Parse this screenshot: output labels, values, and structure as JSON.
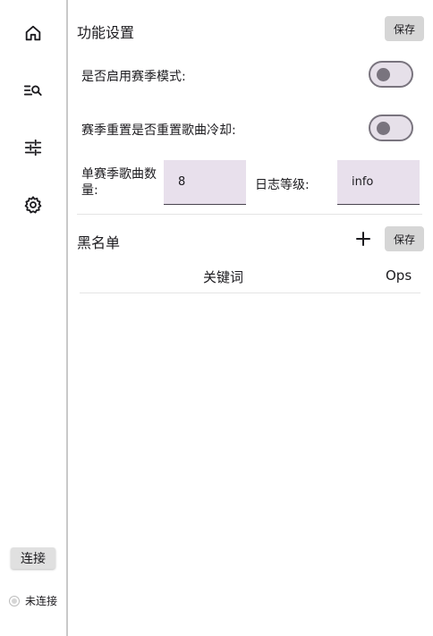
{
  "sidebar": {
    "nav": [
      {
        "icon": "home-icon"
      },
      {
        "icon": "search-list-icon"
      },
      {
        "icon": "tune-sliders-icon"
      },
      {
        "icon": "gear-icon"
      }
    ],
    "connect_label": "连接",
    "status_label": "未连接"
  },
  "features": {
    "title": "功能设置",
    "save_label": "保存",
    "season_mode_label": "是否启用赛季模式:",
    "season_mode_on": false,
    "reset_cooldown_label": "赛季重置是否重置歌曲冷却:",
    "reset_cooldown_on": false,
    "songs_label": "单赛季歌曲数量:",
    "songs_value": "8",
    "log_level_label": "日志等级:",
    "log_level_value": "info"
  },
  "blacklist": {
    "title": "黑名单",
    "save_label": "保存",
    "add_icon": "plus-icon",
    "columns": [
      "关键词",
      "Ops"
    ]
  },
  "colors": {
    "switch_track": "#e6e0e9",
    "switch_outline": "#79747e",
    "field_bg": "#e8e0ec",
    "button_bg": "#d6d6d6"
  }
}
